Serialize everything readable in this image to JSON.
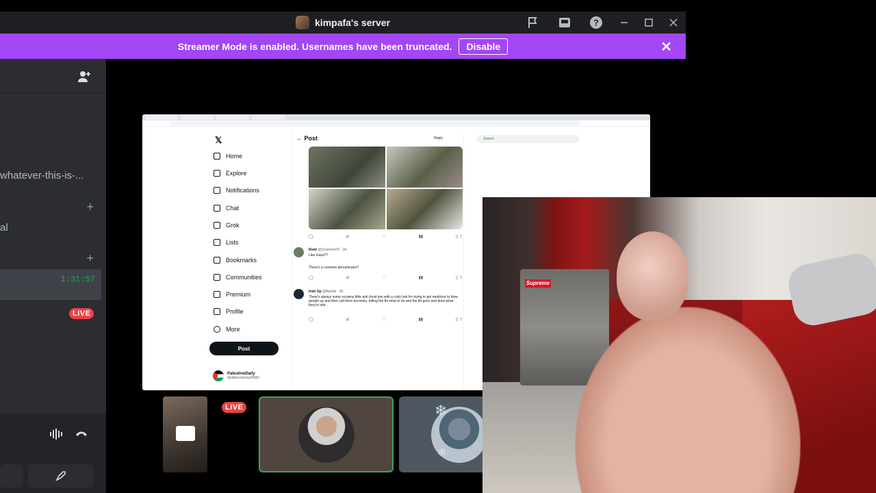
{
  "window": {
    "server_title": "kimpafa's server",
    "icons": [
      "flag-icon",
      "inbox-icon",
      "help-icon",
      "minimize-icon",
      "maximize-icon",
      "close-icon"
    ]
  },
  "banner": {
    "text": "Streamer Mode is enabled. Usernames have been truncated.",
    "button": "Disable",
    "color": "#a346f5"
  },
  "sidebar": {
    "channel_1": "whatever-this-is-...",
    "channel_2": "al",
    "timer": "1:31:57",
    "live_label": "LIVE",
    "accent_green": "#23a55a",
    "live_color": "#ed4245"
  },
  "stream": {
    "x_nav": [
      "Home",
      "Explore",
      "Notifications",
      "Chat",
      "Grok",
      "Lists",
      "Bookmarks",
      "Communities",
      "Premium",
      "Profile",
      "More"
    ],
    "x_post_button": "Post",
    "column_title": "Post",
    "reply_label": "Reply",
    "search_placeholder": "Search",
    "account_name": "PalestineDaily",
    "account_handle": "@abdunrahma24892",
    "tweet1_name": "Rodz",
    "tweet1_handle": "@Charmed78 · 2m",
    "tweet1_text_a": "Like Gaza??",
    "tweet1_text_b": "There's a common denominator!!",
    "tweet2_name": "Intel Op",
    "tweet2_handle": "@Bpintel · 3h",
    "tweet2_text": "There's always some scrawny little anti christ jew with a curly hair fro trying to get medicine to blow people up and then call them terrorists, telling the fbi what to do and the fbi goes and does what they're told."
  },
  "tiles": {
    "live_label": "LIVE",
    "speaking_border": "#3ba55c"
  }
}
